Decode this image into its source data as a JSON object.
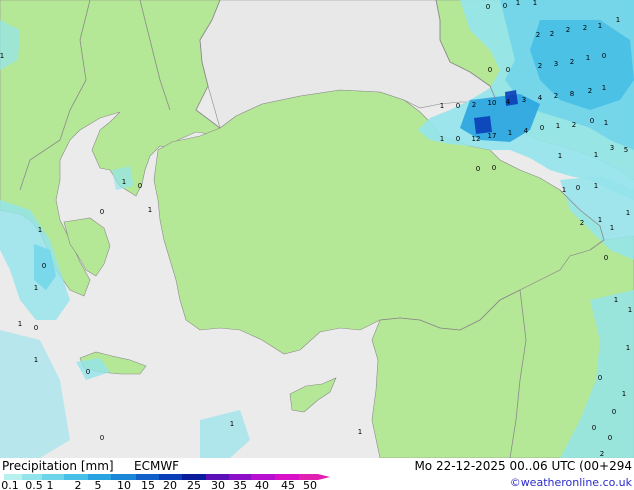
{
  "header": {
    "product_label": "Precipitation [mm]",
    "model_label": "ECMWF",
    "valid_time": "Mo 22-12-2025 00..06 UTC (00+294",
    "credit": "©weatheronline.co.uk"
  },
  "legend": {
    "ticks": [
      "0.1",
      "0.5",
      "1",
      "2",
      "5",
      "10",
      "15",
      "20",
      "25",
      "30",
      "35",
      "40",
      "45",
      "50"
    ],
    "colors": [
      "#b8f0f0",
      "#94e4ec",
      "#6ed4ea",
      "#48bfe6",
      "#2aa4e0",
      "#1a86d6",
      "#1060c8",
      "#0a3eb8",
      "#081c9c",
      "#5c10b8",
      "#8c10c8",
      "#b810d0",
      "#d810c8",
      "#e020b0"
    ]
  },
  "map_colors": {
    "sea": "#ebebeb",
    "land_model": "#b5e896",
    "land_outside": "#e8e8e8",
    "border": "#8a8a8a",
    "coast": "#8a8a8a"
  },
  "precip_labels": [
    {
      "id": "n1",
      "text": "0"
    },
    {
      "id": "n2",
      "text": "0"
    },
    {
      "id": "n3",
      "text": "1"
    },
    {
      "id": "n4",
      "text": "1"
    },
    {
      "id": "n5",
      "text": "2"
    },
    {
      "id": "n6",
      "text": "2"
    },
    {
      "id": "n7",
      "text": "2"
    },
    {
      "id": "n8",
      "text": "2"
    },
    {
      "id": "n9",
      "text": "1"
    },
    {
      "id": "n10",
      "text": "1"
    },
    {
      "id": "n11",
      "text": "2"
    },
    {
      "id": "n12",
      "text": "3"
    },
    {
      "id": "n13",
      "text": "2"
    },
    {
      "id": "n14",
      "text": "1"
    },
    {
      "id": "n15",
      "text": "0"
    },
    {
      "id": "n16",
      "text": "0"
    },
    {
      "id": "n17",
      "text": "0"
    },
    {
      "id": "n18",
      "text": "1"
    },
    {
      "id": "n19",
      "text": "0"
    },
    {
      "id": "n20",
      "text": "2"
    },
    {
      "id": "n21",
      "text": "10"
    },
    {
      "id": "n22",
      "text": "4"
    },
    {
      "id": "n23",
      "text": "3"
    },
    {
      "id": "n24",
      "text": "4"
    },
    {
      "id": "n25",
      "text": "2"
    },
    {
      "id": "n26",
      "text": "8"
    },
    {
      "id": "n27",
      "text": "2"
    },
    {
      "id": "n28",
      "text": "1"
    },
    {
      "id": "n29",
      "text": "1"
    },
    {
      "id": "n30",
      "text": "0"
    },
    {
      "id": "n31",
      "text": "12"
    },
    {
      "id": "n32",
      "text": "17"
    },
    {
      "id": "n33",
      "text": "1"
    },
    {
      "id": "n34",
      "text": "4"
    },
    {
      "id": "n35",
      "text": "0"
    },
    {
      "id": "n36",
      "text": "1"
    },
    {
      "id": "n37",
      "text": "2"
    },
    {
      "id": "n38",
      "text": "0"
    },
    {
      "id": "n39",
      "text": "1"
    },
    {
      "id": "n40",
      "text": "0"
    },
    {
      "id": "n41",
      "text": "0"
    },
    {
      "id": "n42",
      "text": "1"
    },
    {
      "id": "n43",
      "text": "3"
    },
    {
      "id": "n44",
      "text": "5"
    },
    {
      "id": "n45",
      "text": "1"
    },
    {
      "id": "n46",
      "text": "1"
    },
    {
      "id": "n47",
      "text": "0"
    },
    {
      "id": "n48",
      "text": "1"
    },
    {
      "id": "n49",
      "text": "2"
    },
    {
      "id": "n50",
      "text": "1"
    },
    {
      "id": "n51",
      "text": "1"
    },
    {
      "id": "n52",
      "text": "1"
    },
    {
      "id": "n53",
      "text": "0"
    },
    {
      "id": "n54",
      "text": "0"
    },
    {
      "id": "n55",
      "text": "1"
    },
    {
      "id": "n56",
      "text": "0"
    },
    {
      "id": "n57",
      "text": "1"
    },
    {
      "id": "n58",
      "text": "0"
    },
    {
      "id": "n59",
      "text": "1"
    },
    {
      "id": "n60",
      "text": "1"
    },
    {
      "id": "n61",
      "text": "0"
    },
    {
      "id": "n62",
      "text": "1"
    },
    {
      "id": "n63",
      "text": "0"
    },
    {
      "id": "n64",
      "text": "1"
    },
    {
      "id": "n65",
      "text": "0"
    },
    {
      "id": "n66",
      "text": "1"
    },
    {
      "id": "n67",
      "text": "1"
    },
    {
      "id": "n68",
      "text": "1"
    },
    {
      "id": "n69",
      "text": "0"
    },
    {
      "id": "n70",
      "text": "2"
    },
    {
      "id": "n71",
      "text": "0"
    },
    {
      "id": "n72",
      "text": "0"
    },
    {
      "id": "n73",
      "text": "1"
    },
    {
      "id": "n74",
      "text": "1"
    },
    {
      "id": "n75",
      "text": "0"
    },
    {
      "id": "n76",
      "text": "1"
    },
    {
      "id": "n77",
      "text": "1"
    }
  ]
}
